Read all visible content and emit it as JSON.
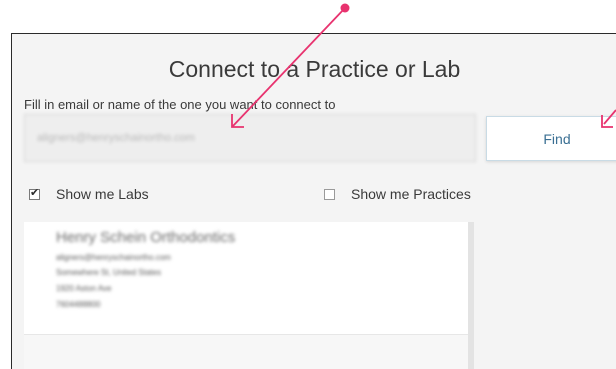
{
  "dialog": {
    "title": "Connect to a Practice or Lab",
    "instruction": "Fill in email or name of the one you want to connect to"
  },
  "search": {
    "value": "aligners@henryschainortho.com",
    "find_label": "Find"
  },
  "filters": {
    "labs": {
      "label": "Show me Labs",
      "checked": true
    },
    "practices": {
      "label": "Show me Practices",
      "checked": false
    }
  },
  "results": [
    {
      "name": "Henry Schein Orthodontics",
      "email": "aligners@henryschainortho.com",
      "location": "Somewhere St, United States",
      "address": "1920 Aston Ave",
      "phone": "7604488800"
    }
  ],
  "annotations": {
    "color": "#e8336f"
  },
  "icons": {
    "checkmark": "check-icon",
    "arrow": "pink-arrow-icon"
  }
}
